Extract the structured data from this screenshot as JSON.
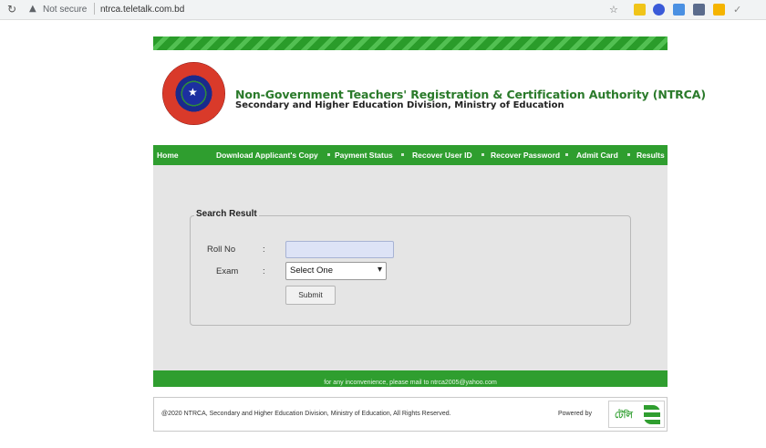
{
  "browser": {
    "reload_icon": "reload-icon",
    "security_label": "Not secure",
    "url": "ntrca.teletalk.com.bd"
  },
  "header": {
    "logo_icon": "ntrca-logo",
    "title": "Non-Government Teachers' Registration & Certification Authority (NTRCA)",
    "subtitle": "Secondary and Higher Education Division, Ministry of Education"
  },
  "nav": {
    "items": [
      "Home",
      "Download Applicant's Copy",
      "Payment Status",
      "Recover User ID",
      "Recover Password",
      "Admit Card",
      "Results"
    ]
  },
  "search": {
    "legend": "Search Result",
    "roll_label": "Roll No",
    "exam_label": "Exam",
    "colon": ":",
    "roll_value": "",
    "exam_selected": "Select One",
    "submit_label": "Submit"
  },
  "mailbar": {
    "text": "for any inconvenience, please mail to ntrca2005@yahoo.com"
  },
  "footer": {
    "copyright": "@2020 NTRCA, Secondary and Higher Education Division, Ministry of Education, All Rights Reserved.",
    "powered_by": "Powered by"
  },
  "colors": {
    "brand_green": "#2f9e2f",
    "title_green": "#2a7a2a",
    "panel_gray": "#e5e5e5"
  }
}
